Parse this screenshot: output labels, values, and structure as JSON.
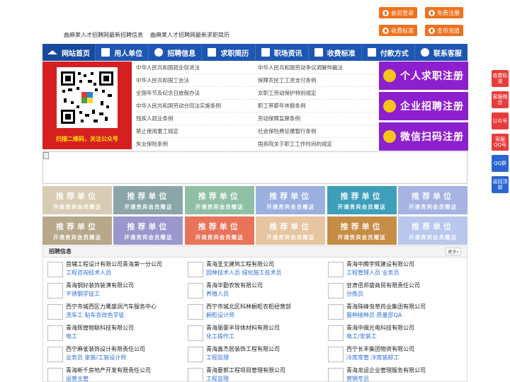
{
  "top_buttons": [
    {
      "label": "会员登录",
      "icon": "user-icon"
    },
    {
      "label": "免费注册",
      "icon": "register-icon"
    },
    {
      "label": "收费标准",
      "icon": "price-icon"
    },
    {
      "label": "金币充值",
      "icon": "coin-icon"
    }
  ],
  "sublinks": [
    "曲麻莱人才招聘网最新招聘信息",
    "曲麻莱人才招聘网最新求职简历"
  ],
  "nav": [
    {
      "label": "网站首页",
      "icon": "home-icon"
    },
    {
      "label": "用人单位",
      "icon": "building-icon"
    },
    {
      "label": "招聘信息",
      "icon": "recruit-icon"
    },
    {
      "label": "求职简历",
      "icon": "resume-icon"
    },
    {
      "label": "职场资讯",
      "icon": "news-icon"
    },
    {
      "label": "收费标准",
      "icon": "fee-icon"
    },
    {
      "label": "付款方式",
      "icon": "payment-icon"
    },
    {
      "label": "联系客服",
      "icon": "service-icon"
    }
  ],
  "qr_caption": "扫描二维码，关注公众号",
  "laws": [
    "中华人民共和国就业促进法",
    "中华人民共和国劳动争议调解仲裁法",
    "中华人民共和国工会法",
    "保障农民工工资支付条例",
    "全国年节及纪念日放假办法",
    "女职工劳动保护特别规定",
    "中华人民共和国劳动合同法实施条例",
    "职工带薪年休假条例",
    "残疾人就业条例",
    "劳动保障监察条例",
    "禁止使用童工规定",
    "社会保险费征缴暂行条例",
    "失业保险条例",
    "国务院关于职工工作时间的规定"
  ],
  "promo": [
    {
      "label": "个人求职注册",
      "icon": "person-icon"
    },
    {
      "label": "企业招聘注册",
      "icon": "enterprise-icon"
    },
    {
      "label": "微信扫码注册",
      "icon": "wechat-icon"
    }
  ],
  "recommend": {
    "title": "推荐单位",
    "subtitle": "开通贵宾会员赠送",
    "colors": [
      "#d9ccb4",
      "#8ba6a8",
      "#8fc0a6",
      "#9bb0df",
      "#3e9fbb",
      "#a7b3e3",
      "#b6a889",
      "#9a97cc",
      "#e8735a",
      "#e6c5a0",
      "#c68d46",
      "#b9c7ed"
    ]
  },
  "jobs": {
    "title": "招聘信息",
    "more": "更多»",
    "items": [
      {
        "company": "首辅工程设计有限公司青海第一分公司",
        "positions": "工程咨询技术人员"
      },
      {
        "company": "青海圣文建筑工程有限公司",
        "positions": "园林技术人员 绿化施工技术员"
      },
      {
        "company": "青海中腾宇辉建设有限公司",
        "positions": "工程管理人员 业务员"
      },
      {
        "company": "青海钢好装饰装潢有限公司",
        "positions": "不锈钢学徒工"
      },
      {
        "company": "青海华勤农牧有限公司",
        "positions": "养殖人员"
      },
      {
        "company": "甘肃佰邦盛商贸有限责任公司",
        "positions": "分拣员"
      },
      {
        "company": "西宁市城西区力鹰盛洞汽车服务中心",
        "positions": "洗车工 贴车衣改色学徒"
      },
      {
        "company": "西宁市城北区科林橱柜衣柜经营部",
        "positions": "橱柜设计师"
      },
      {
        "company": "青海珠峰虫草药业集团有限公司",
        "positions": "菌种接种员 质量部QA"
      },
      {
        "company": "青海辉煌物联科技有限公司",
        "positions": "电工"
      },
      {
        "company": "青海丽豪半导体材料有限公司",
        "positions": "化工操作工"
      },
      {
        "company": "青海中闽光电科技有限公司",
        "positions": "电工/安装工"
      },
      {
        "company": "西宁麻雀装饰设计有限责任公司",
        "positions": "业务员 家装/工装设计师"
      },
      {
        "company": "青海鑫杰居装饰工程有限公司",
        "positions": "工程监理"
      },
      {
        "company": "西宁长丰集团物资有限公司",
        "positions": "冷库库管 冷库装卸工"
      },
      {
        "company": "青海新千房地产开发有限责任公司",
        "positions": "运营主管"
      },
      {
        "company": "青海菱郭工程项目管理有限公司",
        "positions": "工程监理"
      },
      {
        "company": "青海龙运企业管理服务有限公司",
        "positions": "营销专员"
      }
    ]
  },
  "side_bar": [
    {
      "label": "收费标准",
      "color": "#e83c3c"
    },
    {
      "label": "客服微信",
      "color": "#e83c3c"
    },
    {
      "label": "公众号",
      "color": "#e83c3c"
    },
    {
      "label": "客服QQ号",
      "color": "#e83c3c"
    },
    {
      "label": "QQ群",
      "color": "#2a66d2"
    },
    {
      "label": "返回顶部",
      "color": "#2a66d2"
    }
  ]
}
